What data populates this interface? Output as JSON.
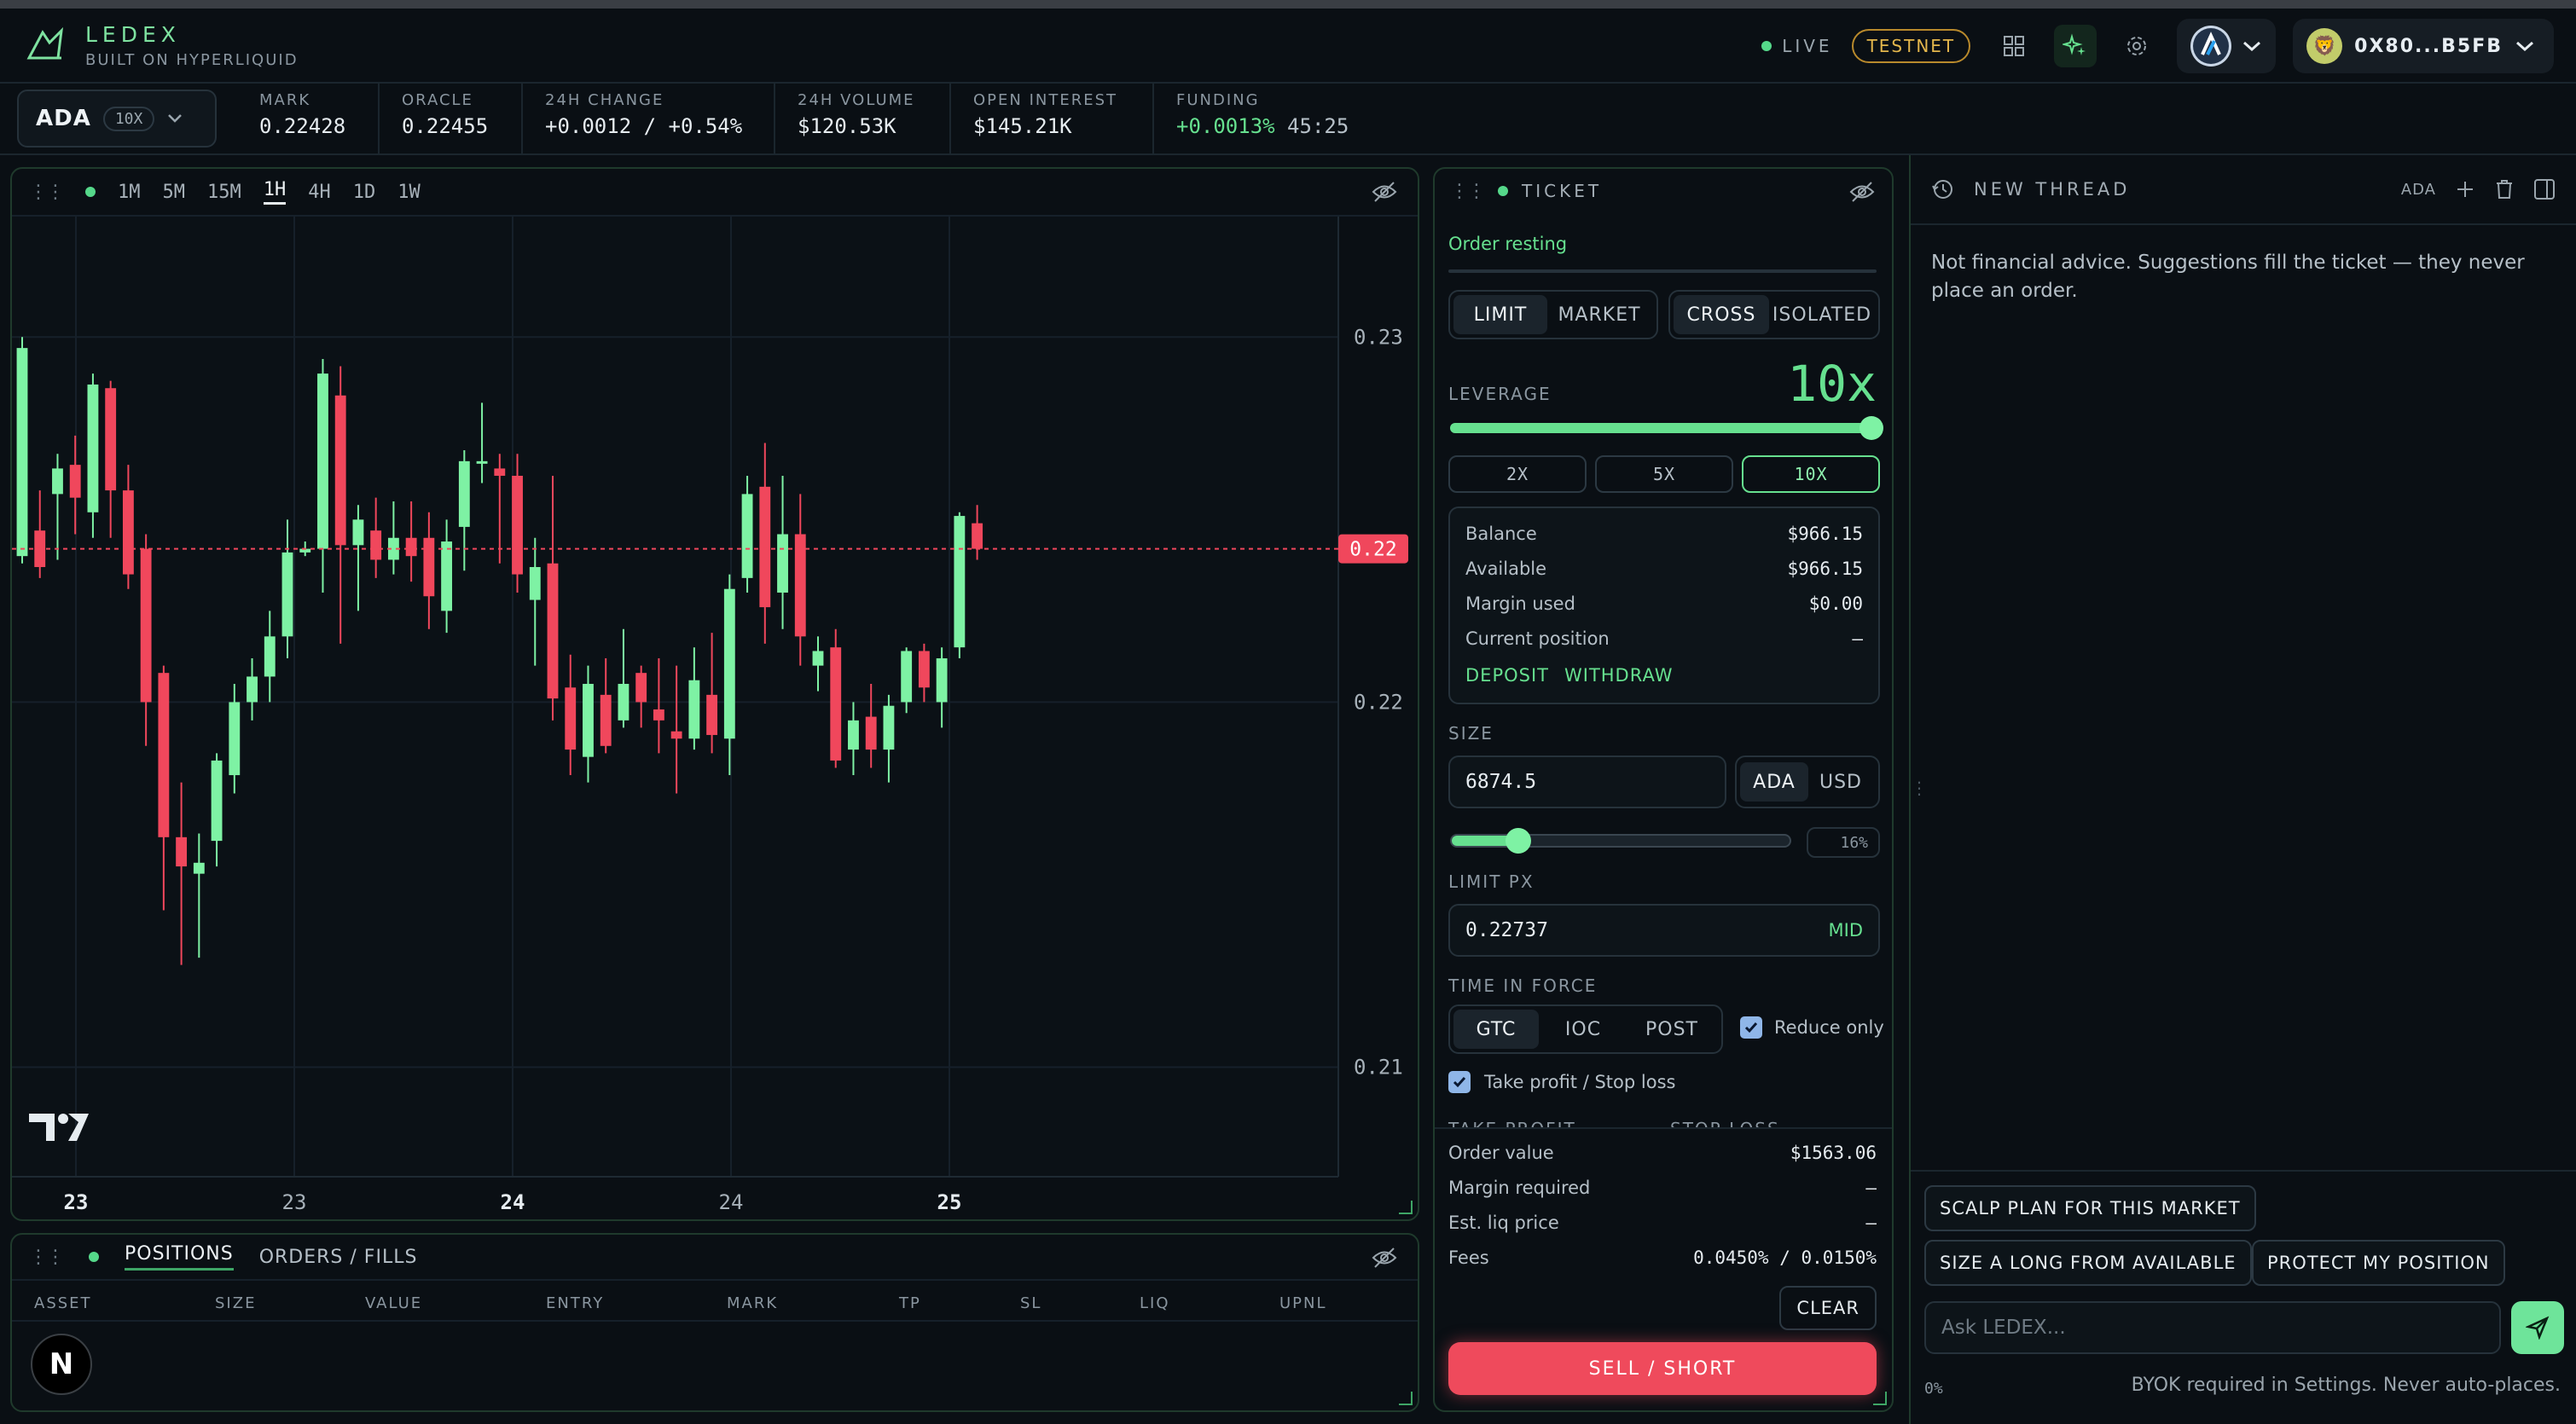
{
  "header": {
    "brand": "LEDEX",
    "subtitle": "BUILT ON HYPERLIQUID",
    "live_label": "LIVE",
    "network_badge": "TESTNET",
    "wallet_address": "0X80...B5FB"
  },
  "market": {
    "asset": "ADA",
    "leverage_pill": "10X",
    "stats": [
      {
        "label": "MARK",
        "value": "0.22428"
      },
      {
        "label": "ORACLE",
        "value": "0.22455"
      },
      {
        "label": "24H CHANGE",
        "value": "+0.0012 / +0.54%"
      },
      {
        "label": "24H VOLUME",
        "value": "$120.53K"
      },
      {
        "label": "OPEN INTEREST",
        "value": "$145.21K"
      },
      {
        "label": "FUNDING",
        "value": "+0.0013%",
        "extra": "45:25"
      }
    ]
  },
  "chart": {
    "timeframes": [
      "1M",
      "5M",
      "15M",
      "1H",
      "4H",
      "1D",
      "1W"
    ],
    "active_timeframe": "1H",
    "price_tag": "0.22",
    "logo_text": "TV"
  },
  "chart_data": {
    "type": "candlestick",
    "y_ticks": [
      "0.23",
      "0.22",
      "0.21"
    ],
    "x_ticks": [
      "23",
      "23",
      "24",
      "24",
      "25"
    ],
    "ylim": [
      0.207,
      0.2333
    ],
    "current_price": 0.2242,
    "candles": [
      {
        "o": 0.224,
        "h": 0.23,
        "l": 0.2238,
        "c": 0.2297
      },
      {
        "o": 0.2247,
        "h": 0.2258,
        "l": 0.2234,
        "c": 0.2237
      },
      {
        "o": 0.2257,
        "h": 0.2268,
        "l": 0.2239,
        "c": 0.2264
      },
      {
        "o": 0.2265,
        "h": 0.2273,
        "l": 0.2246,
        "c": 0.2256
      },
      {
        "o": 0.2252,
        "h": 0.229,
        "l": 0.2245,
        "c": 0.2287
      },
      {
        "o": 0.2286,
        "h": 0.2288,
        "l": 0.2245,
        "c": 0.2258
      },
      {
        "o": 0.2258,
        "h": 0.2265,
        "l": 0.2231,
        "c": 0.2235
      },
      {
        "o": 0.2242,
        "h": 0.2246,
        "l": 0.2188,
        "c": 0.22
      },
      {
        "o": 0.2208,
        "h": 0.221,
        "l": 0.2143,
        "c": 0.2163
      },
      {
        "o": 0.2163,
        "h": 0.2178,
        "l": 0.2128,
        "c": 0.2155
      },
      {
        "o": 0.2153,
        "h": 0.2164,
        "l": 0.213,
        "c": 0.2156
      },
      {
        "o": 0.2162,
        "h": 0.2186,
        "l": 0.2155,
        "c": 0.2184
      },
      {
        "o": 0.218,
        "h": 0.2205,
        "l": 0.2175,
        "c": 0.22
      },
      {
        "o": 0.22,
        "h": 0.2212,
        "l": 0.2195,
        "c": 0.2207
      },
      {
        "o": 0.2207,
        "h": 0.2225,
        "l": 0.22,
        "c": 0.2218
      },
      {
        "o": 0.2218,
        "h": 0.225,
        "l": 0.2212,
        "c": 0.2241
      },
      {
        "o": 0.2241,
        "h": 0.2244,
        "l": 0.224,
        "c": 0.2242
      },
      {
        "o": 0.2242,
        "h": 0.2294,
        "l": 0.223,
        "c": 0.229
      },
      {
        "o": 0.2284,
        "h": 0.2292,
        "l": 0.2216,
        "c": 0.2243
      },
      {
        "o": 0.2243,
        "h": 0.2254,
        "l": 0.2225,
        "c": 0.225
      },
      {
        "o": 0.2247,
        "h": 0.2256,
        "l": 0.2234,
        "c": 0.2239
      },
      {
        "o": 0.2239,
        "h": 0.2255,
        "l": 0.2235,
        "c": 0.2245
      },
      {
        "o": 0.2245,
        "h": 0.2255,
        "l": 0.2233,
        "c": 0.224
      },
      {
        "o": 0.2245,
        "h": 0.2252,
        "l": 0.222,
        "c": 0.2229
      },
      {
        "o": 0.2225,
        "h": 0.225,
        "l": 0.2219,
        "c": 0.2244
      },
      {
        "o": 0.2248,
        "h": 0.2269,
        "l": 0.2236,
        "c": 0.2266
      },
      {
        "o": 0.2266,
        "h": 0.2282,
        "l": 0.226,
        "c": 0.2266
      },
      {
        "o": 0.2264,
        "h": 0.2268,
        "l": 0.2238,
        "c": 0.2262
      },
      {
        "o": 0.2262,
        "h": 0.2268,
        "l": 0.223,
        "c": 0.2235
      },
      {
        "o": 0.2228,
        "h": 0.2245,
        "l": 0.221,
        "c": 0.2237
      },
      {
        "o": 0.2238,
        "h": 0.2262,
        "l": 0.2195,
        "c": 0.2201
      },
      {
        "o": 0.2204,
        "h": 0.2213,
        "l": 0.218,
        "c": 0.2187
      },
      {
        "o": 0.2185,
        "h": 0.221,
        "l": 0.2178,
        "c": 0.2205
      },
      {
        "o": 0.2202,
        "h": 0.2212,
        "l": 0.2186,
        "c": 0.2188
      },
      {
        "o": 0.2195,
        "h": 0.222,
        "l": 0.2193,
        "c": 0.2205
      },
      {
        "o": 0.2208,
        "h": 0.221,
        "l": 0.2193,
        "c": 0.22
      },
      {
        "o": 0.2198,
        "h": 0.2212,
        "l": 0.2186,
        "c": 0.2195
      },
      {
        "o": 0.2192,
        "h": 0.221,
        "l": 0.2175,
        "c": 0.219
      },
      {
        "o": 0.219,
        "h": 0.2215,
        "l": 0.2187,
        "c": 0.2206
      },
      {
        "o": 0.2202,
        "h": 0.2219,
        "l": 0.2186,
        "c": 0.2191
      },
      {
        "o": 0.219,
        "h": 0.2235,
        "l": 0.218,
        "c": 0.2231
      },
      {
        "o": 0.2234,
        "h": 0.2262,
        "l": 0.223,
        "c": 0.2257
      },
      {
        "o": 0.2259,
        "h": 0.2271,
        "l": 0.2216,
        "c": 0.2226
      },
      {
        "o": 0.223,
        "h": 0.2262,
        "l": 0.222,
        "c": 0.2246
      },
      {
        "o": 0.2246,
        "h": 0.2257,
        "l": 0.221,
        "c": 0.2218
      },
      {
        "o": 0.221,
        "h": 0.2218,
        "l": 0.2203,
        "c": 0.2214
      },
      {
        "o": 0.2215,
        "h": 0.222,
        "l": 0.2182,
        "c": 0.2184
      },
      {
        "o": 0.2187,
        "h": 0.22,
        "l": 0.218,
        "c": 0.2195
      },
      {
        "o": 0.2196,
        "h": 0.2205,
        "l": 0.2182,
        "c": 0.2187
      },
      {
        "o": 0.2187,
        "h": 0.2202,
        "l": 0.2178,
        "c": 0.2199
      },
      {
        "o": 0.22,
        "h": 0.2215,
        "l": 0.2197,
        "c": 0.2214
      },
      {
        "o": 0.2214,
        "h": 0.2216,
        "l": 0.22,
        "c": 0.2204
      },
      {
        "o": 0.22,
        "h": 0.2215,
        "l": 0.2193,
        "c": 0.2212
      },
      {
        "o": 0.2215,
        "h": 0.2252,
        "l": 0.2212,
        "c": 0.2251
      },
      {
        "o": 0.2249,
        "h": 0.2254,
        "l": 0.2239,
        "c": 0.2242
      }
    ]
  },
  "positions": {
    "tabs": [
      "POSITIONS",
      "ORDERS / FILLS"
    ],
    "columns": [
      "ASSET",
      "SIZE",
      "VALUE",
      "ENTRY",
      "MARK",
      "TP",
      "SL",
      "LIQ",
      "UPNL"
    ],
    "n_button": "N"
  },
  "ticket": {
    "title": "TICKET",
    "status": "Order resting",
    "order_types": [
      "LIMIT",
      "MARKET"
    ],
    "margin_modes": [
      "CROSS",
      "ISOLATED"
    ],
    "leverage_label": "LEVERAGE",
    "leverage_value": "10x",
    "leverage_fraction": 1.0,
    "leverage_chips": [
      "2X",
      "5X",
      "10X"
    ],
    "account": [
      {
        "label": "Balance",
        "value": "$966.15"
      },
      {
        "label": "Available",
        "value": "$966.15"
      },
      {
        "label": "Margin used",
        "value": "$0.00"
      },
      {
        "label": "Current position",
        "value": "–"
      }
    ],
    "deposit": "DEPOSIT",
    "withdraw": "WITHDRAW",
    "size_label": "SIZE",
    "size_value": "6874.5",
    "size_units": [
      "ADA",
      "USD"
    ],
    "size_pct": "16%",
    "size_fraction": 0.16,
    "limit_label": "LIMIT PX",
    "limit_value": "0.22737",
    "mid_label": "MID",
    "tif_label": "TIME IN FORCE",
    "tif_options": [
      "GTC",
      "IOC",
      "POST"
    ],
    "reduce_only": "Reduce only",
    "tpsl": "Take profit / Stop loss",
    "tp_label": "TAKE PROFIT",
    "sl_label": "STOP LOSS",
    "summary": [
      {
        "label": "Order value",
        "value": "$1563.06"
      },
      {
        "label": "Margin required",
        "value": "–"
      },
      {
        "label": "Est. liq price",
        "value": "–"
      },
      {
        "label": "Fees",
        "value": "0.0450% / 0.0150%"
      }
    ],
    "clear": "CLEAR",
    "sell": "SELL / SHORT"
  },
  "assistant": {
    "title": "NEW THREAD",
    "asset_tag": "ADA",
    "disclaimer": "Not financial advice. Suggestions fill the ticket — they never place an order.",
    "suggestions": [
      "SCALP PLAN FOR THIS MARKET",
      "SIZE A LONG FROM AVAILABLE",
      "PROTECT MY POSITION"
    ],
    "input_placeholder": "Ask LEDEX...",
    "usage": "0%",
    "footer_note": "BYOK required in Settings. Never auto-places."
  },
  "colors": {
    "accent": "#66e08f",
    "sell": "#ef4a5c",
    "up": "#7ef2a4",
    "down": "#f0475c"
  }
}
